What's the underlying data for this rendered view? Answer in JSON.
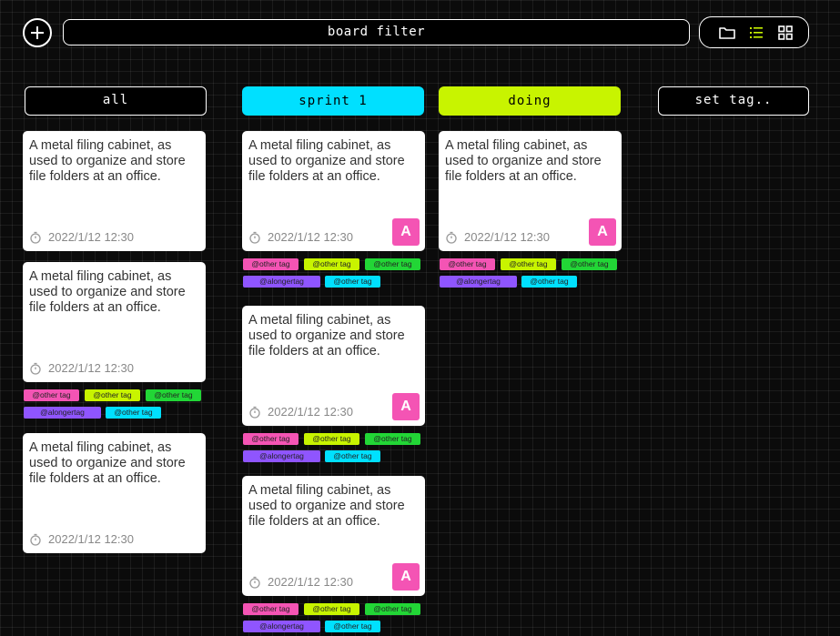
{
  "toolbar": {
    "add_icon": "plus-icon",
    "filter_label": "board filter",
    "views": [
      "folder-icon",
      "list-icon",
      "grid-icon"
    ],
    "active_view": "list-icon",
    "accent": "#c8f400"
  },
  "columns": [
    {
      "label": "all"
    },
    {
      "label": "sprint 1",
      "color": "#00e0ff"
    },
    {
      "label": "doing",
      "color": "#c8f400"
    },
    {
      "label": "set tag.."
    }
  ],
  "card": {
    "text": "A metal filing cabinet, as used to organize and store file folders at an office.",
    "timestamp": "2022/1/12 12:30",
    "avatar": "A",
    "avatar_color": "#f454b4"
  },
  "tags": [
    {
      "label": "@other tag",
      "color": "#f454b4"
    },
    {
      "label": "@other tag",
      "color": "#c8f400"
    },
    {
      "label": "@other tag",
      "color": "#22d636"
    },
    {
      "label": "@alongertag",
      "color": "#8f55ff"
    },
    {
      "label": "@other tag",
      "color": "#00e0ff"
    }
  ]
}
